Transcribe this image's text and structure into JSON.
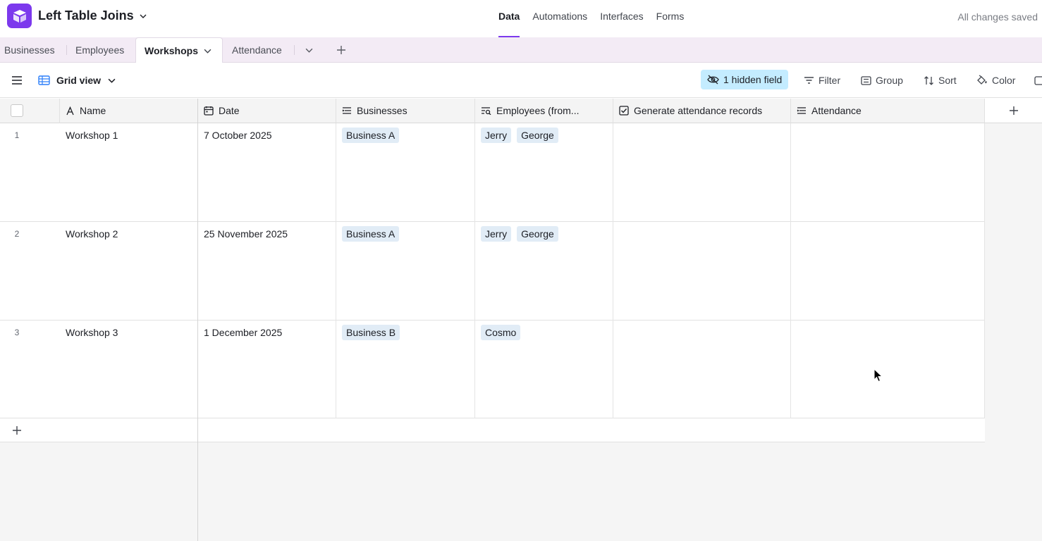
{
  "app": {
    "base_title": "Left Table Joins",
    "status": "All changes saved",
    "brand_color": "#7c39ed"
  },
  "topnav": [
    "Data",
    "Automations",
    "Interfaces",
    "Forms"
  ],
  "tables": [
    "Businesses",
    "Employees",
    "Workshops",
    "Attendance"
  ],
  "toolbar": {
    "view_name": "Grid view",
    "hidden_fields": "1 hidden field",
    "filter": "Filter",
    "group": "Group",
    "sort": "Sort",
    "color": "Color"
  },
  "columns": [
    {
      "label": "Name",
      "icon": "text-icon"
    },
    {
      "label": "Date",
      "icon": "calendar-icon"
    },
    {
      "label": "Businesses",
      "icon": "link-icon"
    },
    {
      "label": "Employees (from...",
      "icon": "lookup-icon"
    },
    {
      "label": "Generate attendance records",
      "icon": "checkbox-icon"
    },
    {
      "label": "Attendance",
      "icon": "link-icon"
    }
  ],
  "rows": [
    {
      "num": "1",
      "name": "Workshop 1",
      "date": "7 October 2025",
      "businesses": [
        "Business A"
      ],
      "employees": [
        "Jerry",
        "George"
      ]
    },
    {
      "num": "2",
      "name": "Workshop 2",
      "date": "25 November 2025",
      "businesses": [
        "Business A"
      ],
      "employees": [
        "Jerry",
        "George"
      ]
    },
    {
      "num": "3",
      "name": "Workshop 3",
      "date": "1 December 2025",
      "businesses": [
        "Business B"
      ],
      "employees": [
        "Cosmo"
      ]
    }
  ]
}
